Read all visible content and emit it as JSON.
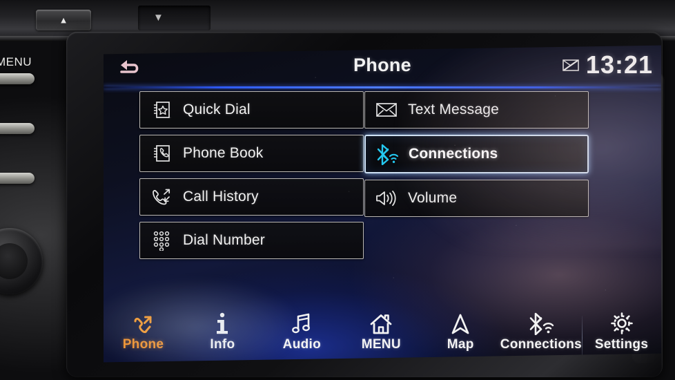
{
  "device": {
    "bezel": {
      "eject_button_glyph": "▲",
      "left_hardkey_label": "MENU"
    }
  },
  "screen": {
    "header": {
      "back_icon": "back-arrow-icon",
      "title": "Phone",
      "status": {
        "message_icon": "message-muted-icon",
        "clock": "13:21"
      }
    },
    "menu": {
      "left_column": [
        {
          "icon": "quick-dial-icon",
          "label": "Quick Dial",
          "selected": false
        },
        {
          "icon": "phone-book-icon",
          "label": "Phone Book",
          "selected": false
        },
        {
          "icon": "call-history-icon",
          "label": "Call History",
          "selected": false
        },
        {
          "icon": "keypad-icon",
          "label": "Dial Number",
          "selected": false
        }
      ],
      "right_column": [
        {
          "icon": "envelope-icon",
          "label": "Text Message",
          "selected": false
        },
        {
          "icon": "bluetooth-wifi-icon",
          "label": "Connections",
          "selected": true
        },
        {
          "icon": "speaker-icon",
          "label": "Volume",
          "selected": false
        }
      ]
    },
    "navbar": [
      {
        "icon": "phone-handset-icon",
        "label": "Phone",
        "active": true,
        "separator_before": false
      },
      {
        "icon": "info-icon",
        "label": "Info",
        "active": false,
        "separator_before": false
      },
      {
        "icon": "music-note-icon",
        "label": "Audio",
        "active": false,
        "separator_before": false
      },
      {
        "icon": "home-icon",
        "label": "MENU",
        "active": false,
        "separator_before": false
      },
      {
        "icon": "navigation-arrow-icon",
        "label": "Map",
        "active": false,
        "separator_before": false
      },
      {
        "icon": "bluetooth-wifi-icon",
        "label": "Connections",
        "active": false,
        "separator_before": false
      },
      {
        "icon": "gear-icon",
        "label": "Settings",
        "active": false,
        "separator_before": true
      }
    ]
  },
  "colors": {
    "accent_blue": "#2f5cff",
    "bluetooth_cyan": "#24c8f0",
    "active_orange": "#f2912a",
    "back_arrow_pink": "#e8c4cd",
    "tile_border": "#e2ded8",
    "selected_border": "#cfe2f5"
  }
}
